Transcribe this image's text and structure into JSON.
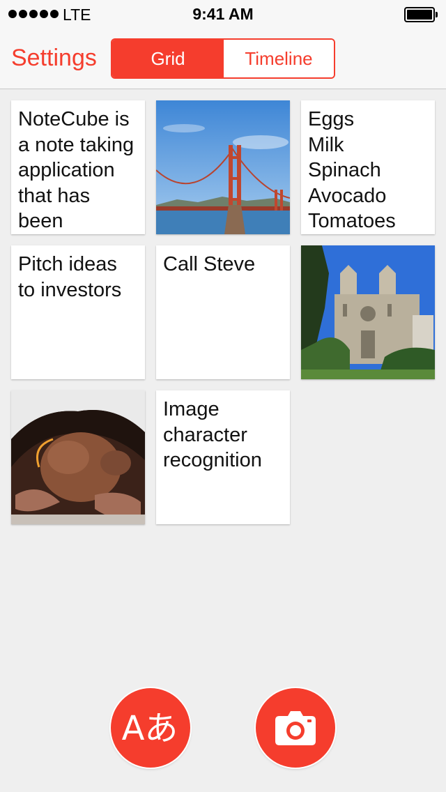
{
  "status_bar": {
    "carrier": "LTE",
    "time": "9:41 AM"
  },
  "nav": {
    "settings_label": "Settings",
    "segments": [
      {
        "label": "Grid",
        "selected": true
      },
      {
        "label": "Timeline",
        "selected": false
      }
    ]
  },
  "notes": [
    {
      "type": "text",
      "text": "NoteCube is\na note taking\napplication\nthat has\nbeen"
    },
    {
      "type": "image",
      "image": "golden-gate-bridge-photo"
    },
    {
      "type": "text",
      "text": "Eggs\nMilk\nSpinach\nAvocado\nTomatoes"
    },
    {
      "type": "text",
      "text": "Pitch ideas\nto investors"
    },
    {
      "type": "text",
      "text": "Call Steve"
    },
    {
      "type": "image",
      "image": "cathedral-photo"
    },
    {
      "type": "image",
      "image": "chocolate-ice-cream-photo"
    },
    {
      "type": "text",
      "text": "Image\ncharacter\nrecognition"
    }
  ],
  "actions": {
    "translate_icon": "translate-icon",
    "translate_glyph": "Aあ",
    "camera_icon": "camera-icon"
  },
  "colors": {
    "accent": "#f53d2d",
    "background": "#efefef",
    "bar": "#f7f7f7"
  }
}
